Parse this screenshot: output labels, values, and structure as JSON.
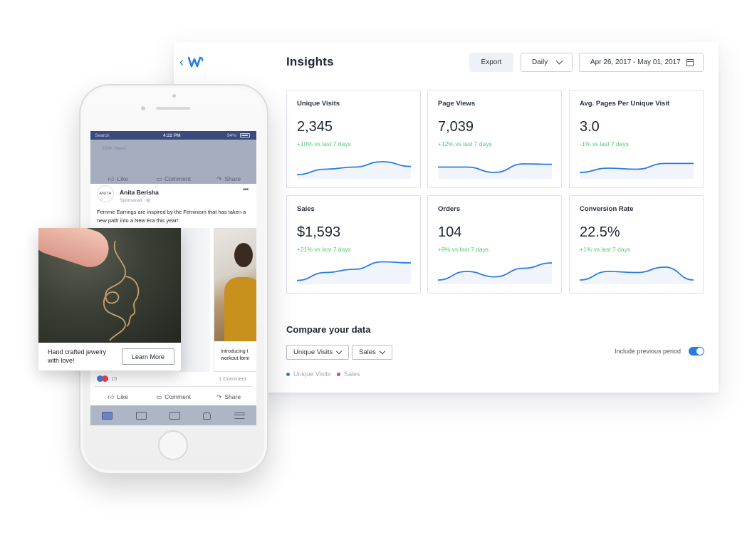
{
  "dashboard": {
    "title": "Insights",
    "export_label": "Export",
    "interval_select": "Daily",
    "date_range": "Apr 26, 2017 - May 01, 2017",
    "accent_color": "#2c7be5",
    "positive_color": "#4ccc6e",
    "metrics": [
      {
        "title": "Unique Visits",
        "value": "2,345",
        "delta": "+10% vs last 7 days"
      },
      {
        "title": "Page Views",
        "value": "7,039",
        "delta": "+12% vs last 7 days"
      },
      {
        "title": "Avg. Pages Per Unique Visit",
        "value": "3.0",
        "delta": "-1% vs last 7 days"
      },
      {
        "title": "Sales",
        "value": "$1,593",
        "delta": "+21% vs last 7 days"
      },
      {
        "title": "Orders",
        "value": "104",
        "delta": "+9% vs last 7 days"
      },
      {
        "title": "Conversion Rate",
        "value": "22.5%",
        "delta": "+1% vs last 7 days"
      }
    ],
    "compare": {
      "title": "Compare your data",
      "dropdown_1": "Unique Visits",
      "dropdown_2": "Sales",
      "toggle_label": "Include previous period",
      "toggle_on": true,
      "legend": [
        {
          "label": "Unique Visits",
          "color": "#2c7be5"
        },
        {
          "label": "Sales",
          "color": "#c43dbf"
        }
      ]
    }
  },
  "phone": {
    "status": {
      "carrier": "Search",
      "time": "4:22 PM",
      "battery": "94%"
    },
    "top_post_views": "300K Views",
    "actions": {
      "like": "Like",
      "comment": "Comment",
      "share": "Share"
    },
    "post": {
      "avatar_text": "ANITA",
      "author": "Anita Berisha",
      "sponsored": "Sponsored · ",
      "text": "Femme Earrings are inspired by the Feminism that has taken a new path into a New Era this year!",
      "card2_caption_1": "Introducing t",
      "card2_caption_2": "workout form",
      "reaction_count": "15",
      "comment_count": "1 Comment"
    },
    "tab_icons": [
      "news-feed-icon",
      "video-icon",
      "marketplace-icon",
      "notifications-icon",
      "menu-icon"
    ]
  },
  "ad_card": {
    "text": "Hand crafted jewelry with love!",
    "button_label": "Learn More"
  },
  "sparklines": [
    [
      0.1,
      0.35,
      0.45,
      0.7,
      0.48
    ],
    [
      0.45,
      0.45,
      0.2,
      0.6,
      0.58
    ],
    [
      0.2,
      0.4,
      0.35,
      0.62,
      0.62
    ],
    [
      0.08,
      0.45,
      0.6,
      0.95,
      0.9
    ],
    [
      0.1,
      0.5,
      0.25,
      0.65,
      0.9
    ],
    [
      0.1,
      0.5,
      0.45,
      0.7,
      0.1
    ]
  ]
}
